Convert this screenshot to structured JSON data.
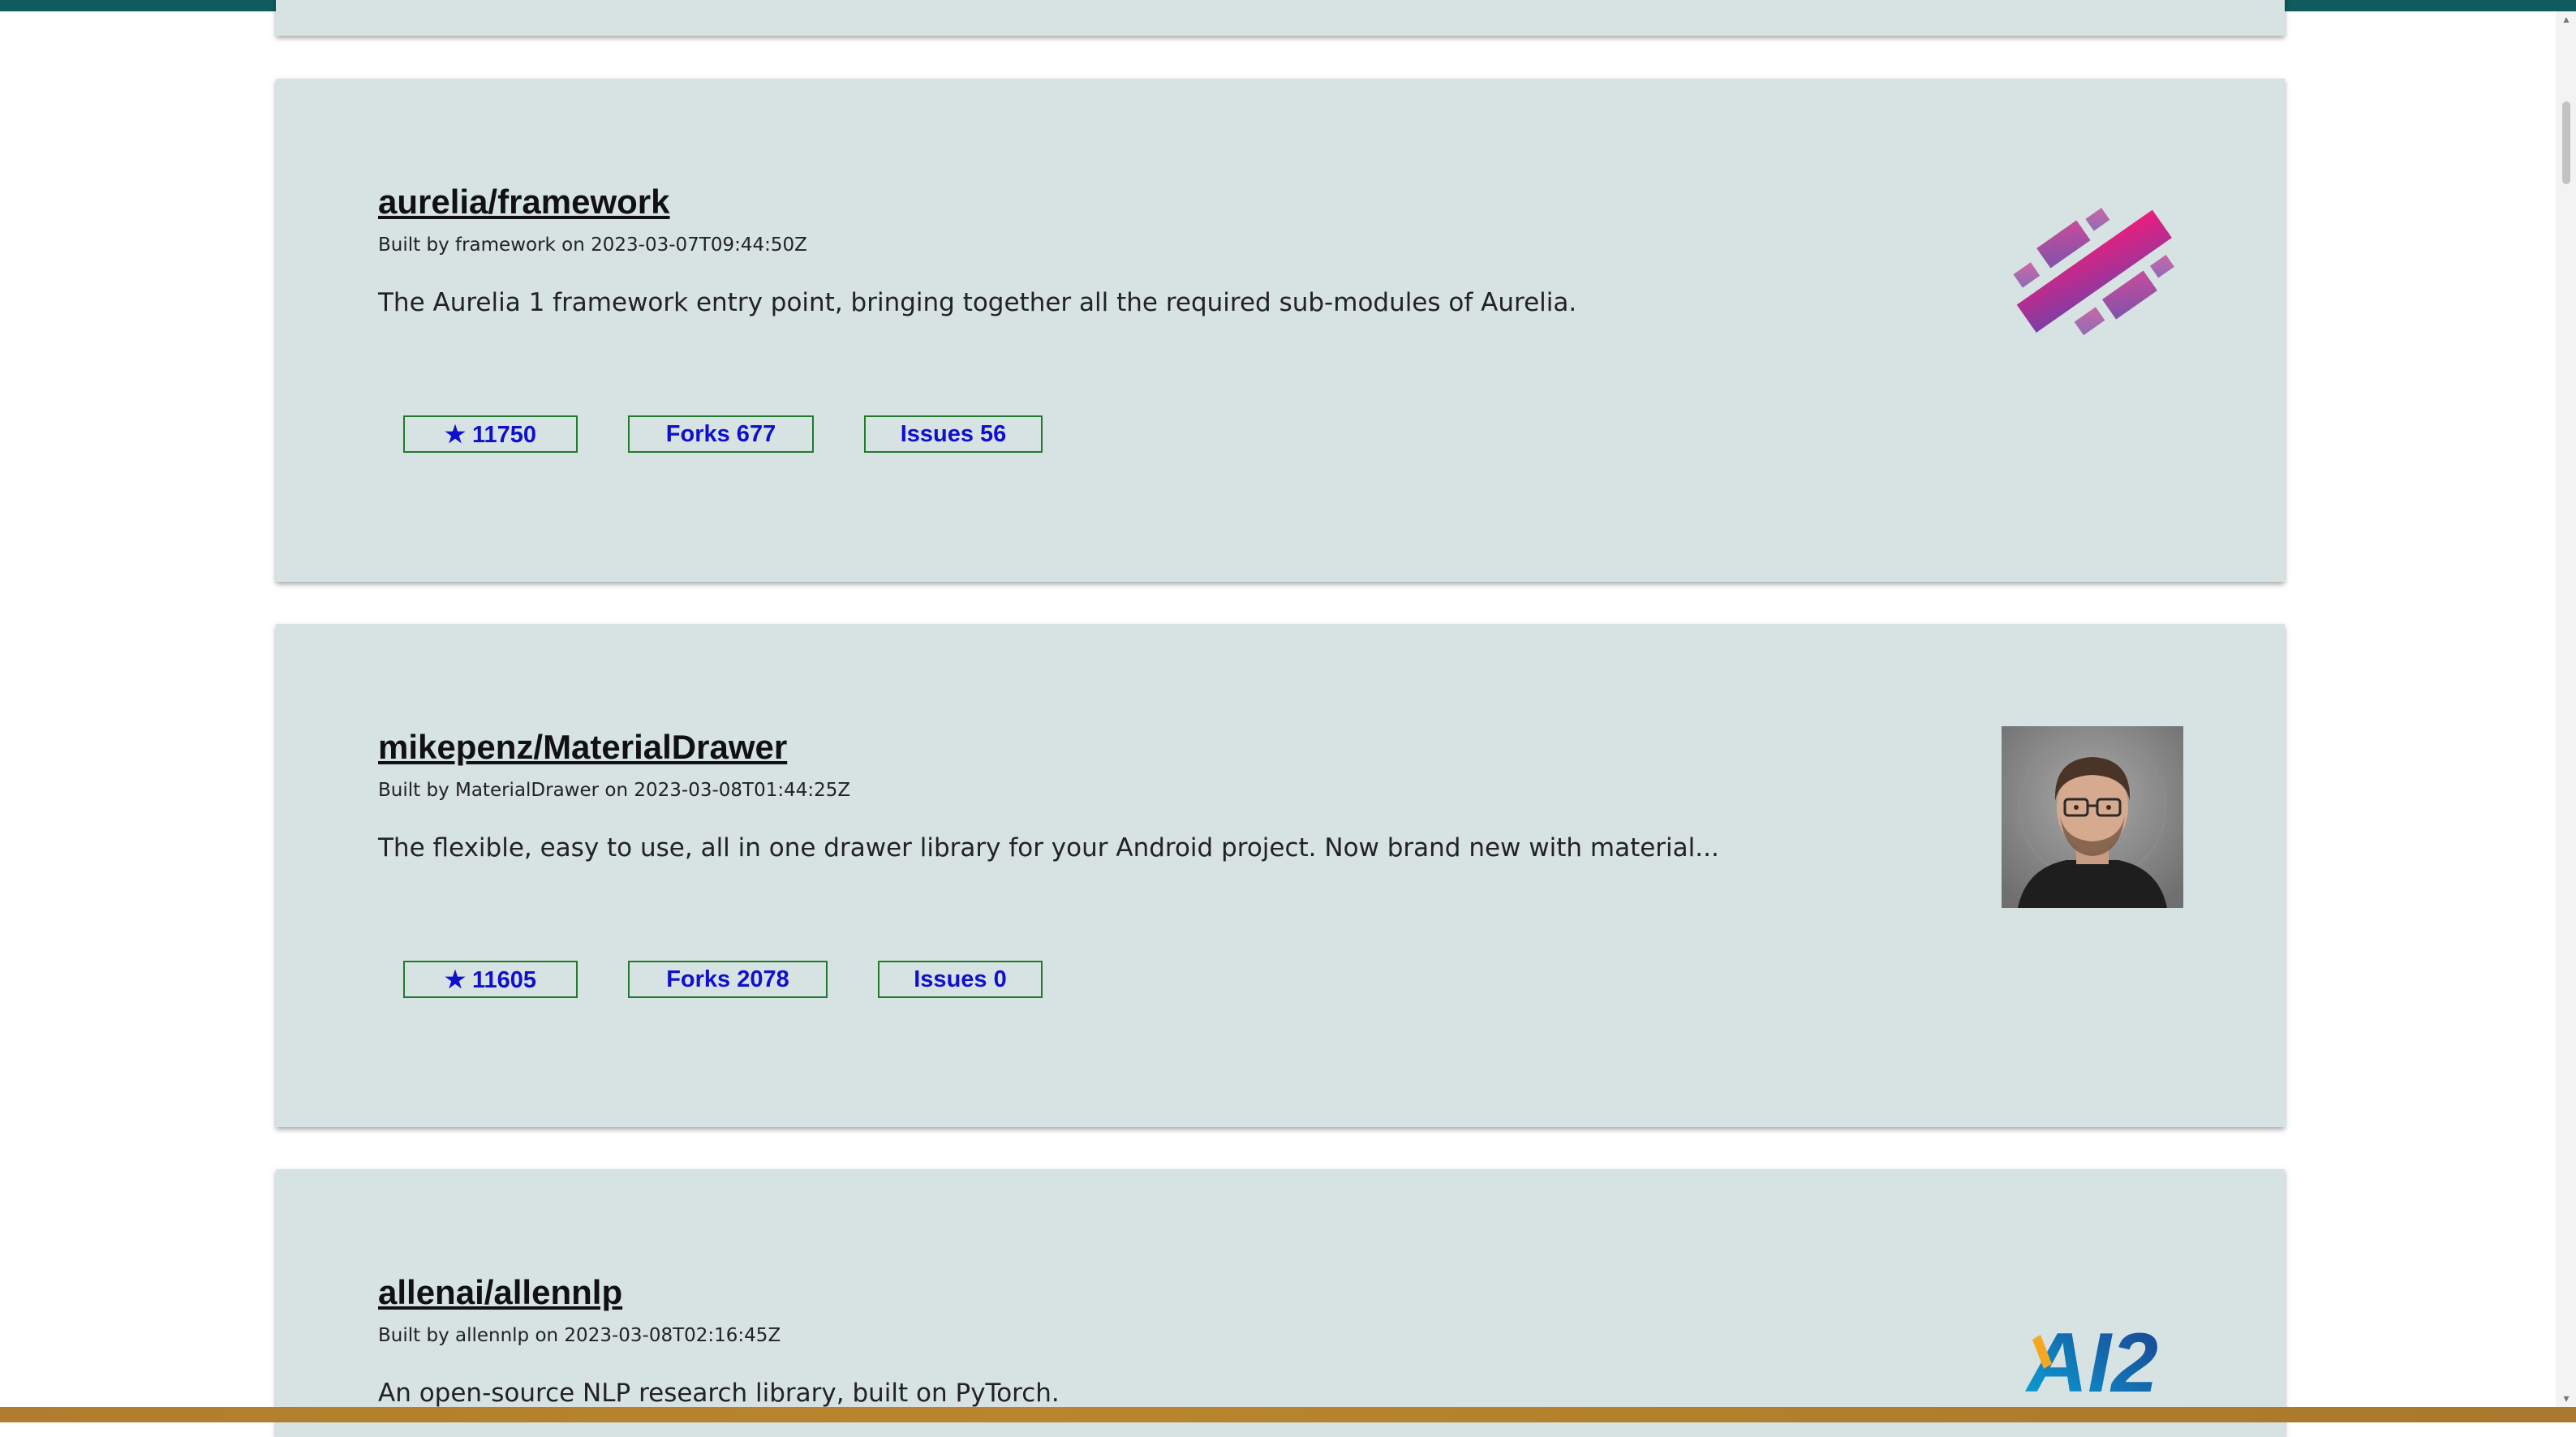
{
  "repos": [
    {
      "title": "aurelia/framework",
      "meta": "Built by framework on 2023-03-07T09:44:50Z",
      "description": "The Aurelia 1 framework entry point, bringing together all the required sub-modules of Aurelia.",
      "stars": "★ 11750",
      "forks": "Forks 677",
      "issues": "Issues 56",
      "avatar_icon": "aurelia-logo-icon"
    },
    {
      "title": "mikepenz/MaterialDrawer",
      "meta": "Built by MaterialDrawer on 2023-03-08T01:44:25Z",
      "description": "The flexible, easy to use, all in one drawer library for your Android project. Now brand new with material...",
      "stars": "★ 11605",
      "forks": "Forks 2078",
      "issues": "Issues 0",
      "avatar_icon": "user-avatar-portrait"
    },
    {
      "title": "allenai/allennlp",
      "meta": "Built by allennlp on 2023-03-08T02:16:45Z",
      "description": "An open-source NLP research library, built on PyTorch.",
      "avatar_icon": "ai2-logo-icon",
      "logo_text": "AI2"
    }
  ],
  "colors": {
    "card_bg": "#d6e3e2",
    "badge_border": "#1f7a2e",
    "badge_text": "#1010cc",
    "top_bar": "#0f5c5d"
  }
}
